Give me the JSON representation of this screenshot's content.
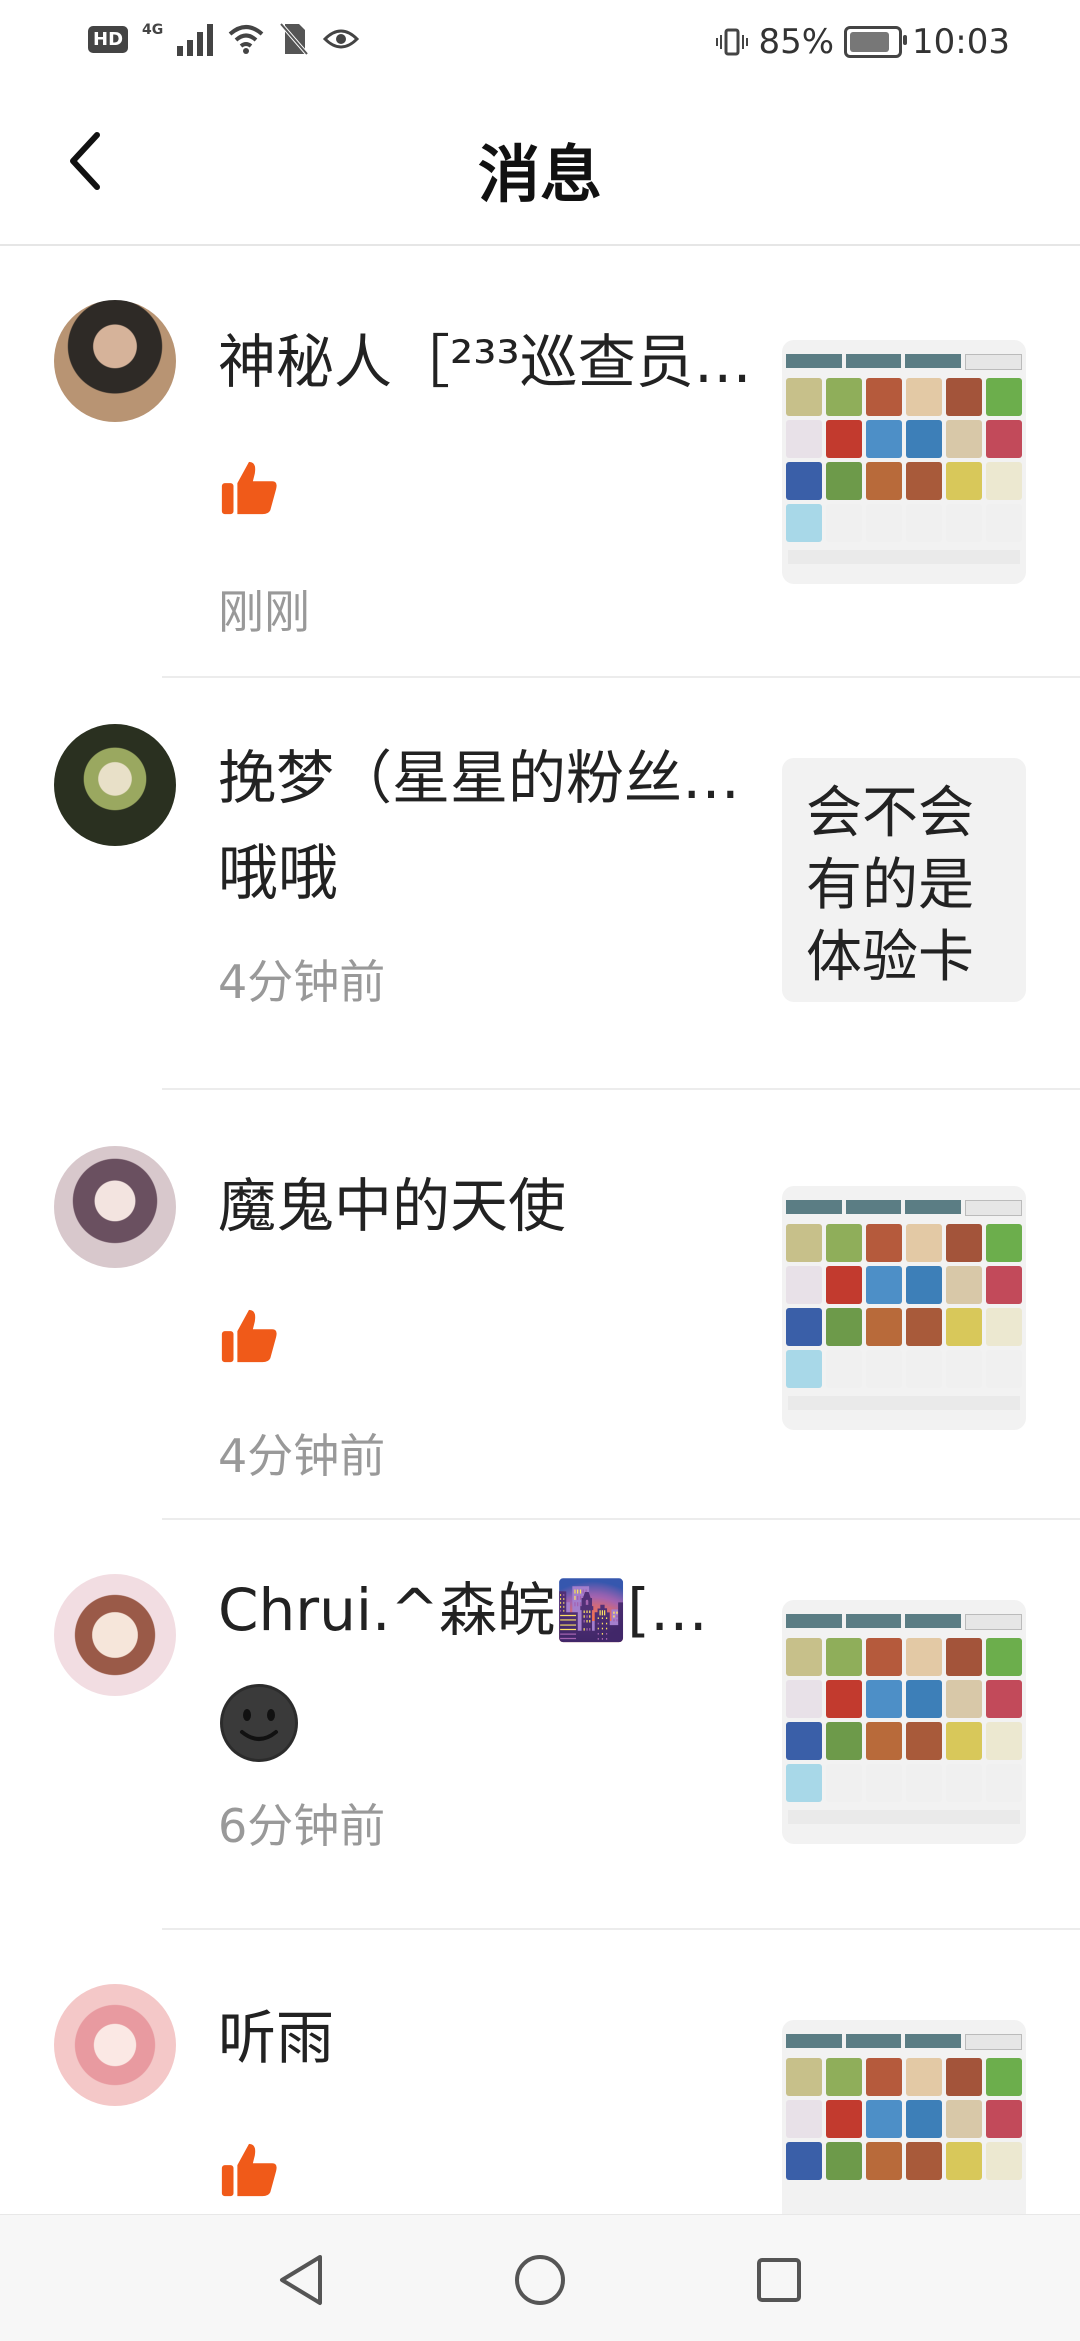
{
  "status_bar": {
    "hd": "HD",
    "network": "4G",
    "battery": "85%",
    "battery_level": 0.85,
    "time": "10:03",
    "icons": [
      "hd-icon",
      "signal-icon",
      "wifi-icon",
      "no-sim-icon",
      "eye-icon",
      "vibrate-icon",
      "battery-icon"
    ]
  },
  "header": {
    "title": "消息",
    "back_icon": "chevron-left-icon"
  },
  "messages": [
    {
      "name": "神秘人［²³³巡查员…",
      "content_type": "like",
      "content_icon": "thumbs-up-icon",
      "time": "刚刚",
      "thumb_type": "item-grid"
    },
    {
      "name": "挽梦（星星的粉丝…",
      "content_type": "text",
      "content": "哦哦",
      "time": "4分钟前",
      "thumb_type": "text",
      "thumb_text": "会不会有的是体验卡"
    },
    {
      "name": "魔鬼中的天使",
      "content_type": "like",
      "content_icon": "thumbs-up-icon",
      "time": "4分钟前",
      "thumb_type": "item-grid"
    },
    {
      "name": "Chrui.^森皖🌆[巡…",
      "content_type": "emoji",
      "content_icon": "smiley-icon",
      "time": "6分钟前",
      "thumb_type": "item-grid"
    },
    {
      "name": "听雨",
      "content_type": "like",
      "content_icon": "thumbs-up-icon",
      "time": "",
      "thumb_type": "item-grid"
    }
  ],
  "colors": {
    "like": "#f05a19",
    "time_text": "#999999",
    "divider": "#ececec",
    "grid_tab": "#5b7d84"
  },
  "nav_bar": {
    "icons": [
      "back-triangle-icon",
      "home-circle-icon",
      "recents-square-icon"
    ]
  }
}
